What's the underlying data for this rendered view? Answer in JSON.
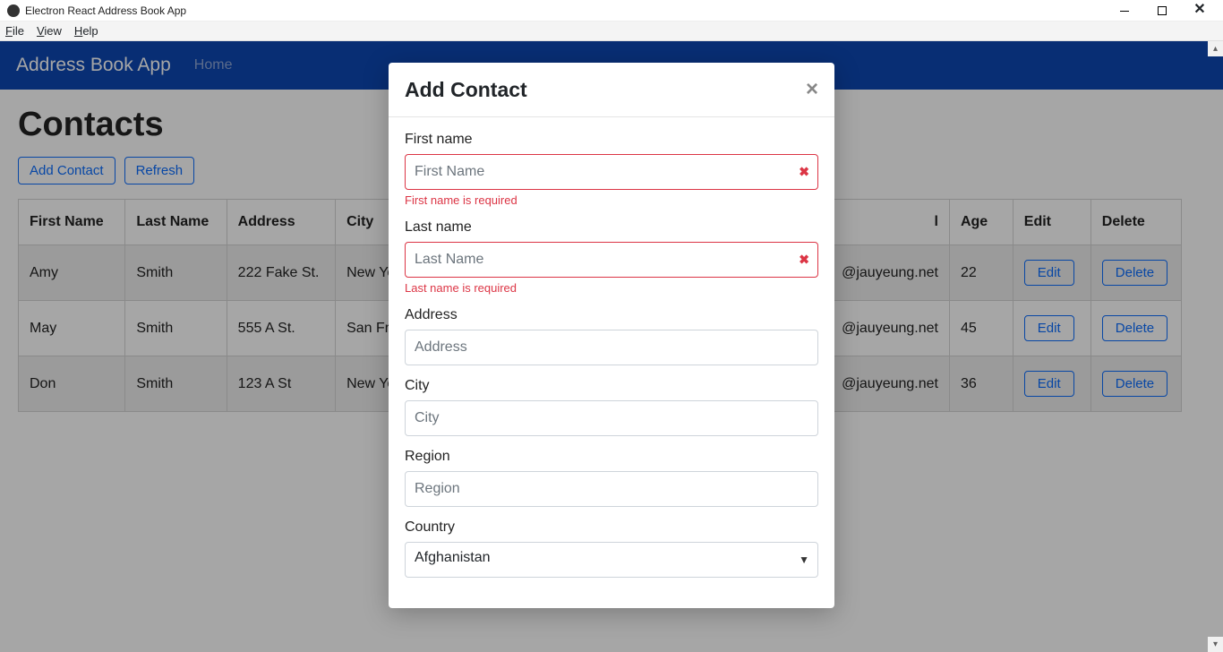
{
  "window": {
    "title": "Electron React Address Book App"
  },
  "menubar": {
    "file": "File",
    "view": "View",
    "help": "Help"
  },
  "navbar": {
    "title": "Address Book App",
    "home": "Home"
  },
  "page": {
    "title": "Contacts",
    "add_contact": "Add Contact",
    "refresh": "Refresh"
  },
  "table": {
    "headers": {
      "first_name": "First Name",
      "last_name": "Last Name",
      "address": "Address",
      "city": "City",
      "email_suffix": "l",
      "age": "Age",
      "edit": "Edit",
      "delete": "Delete"
    },
    "rows": [
      {
        "first_name": "Amy",
        "last_name": "Smith",
        "address": "222 Fake St.",
        "city": "New York",
        "email": "@jauyeung.net",
        "age": "22"
      },
      {
        "first_name": "May",
        "last_name": "Smith",
        "address": "555 A St.",
        "city": "San Francisco",
        "email": "@jauyeung.net",
        "age": "45"
      },
      {
        "first_name": "Don",
        "last_name": "Smith",
        "address": "123 A St",
        "city": "New York",
        "email": "@jauyeung.net",
        "age": "36"
      }
    ],
    "edit_label": "Edit",
    "delete_label": "Delete"
  },
  "modal": {
    "title": "Add Contact",
    "first_name": {
      "label": "First name",
      "placeholder": "First Name",
      "error": "First name is required"
    },
    "last_name": {
      "label": "Last name",
      "placeholder": "Last Name",
      "error": "Last name is required"
    },
    "address": {
      "label": "Address",
      "placeholder": "Address"
    },
    "city": {
      "label": "City",
      "placeholder": "City"
    },
    "region": {
      "label": "Region",
      "placeholder": "Region"
    },
    "country": {
      "label": "Country",
      "value": "Afghanistan"
    }
  }
}
